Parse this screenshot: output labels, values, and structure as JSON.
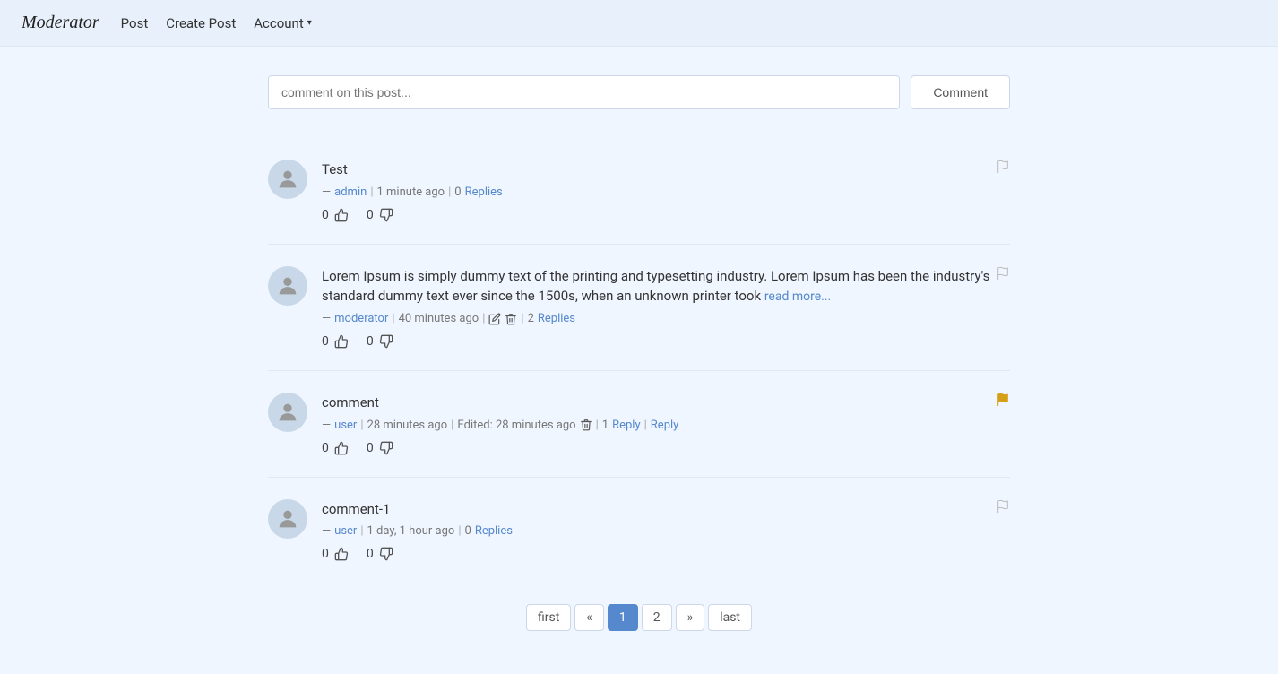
{
  "brand": "Moderator",
  "nav": {
    "post_label": "Post",
    "create_post_label": "Create Post",
    "account_label": "Account"
  },
  "comment_input": {
    "placeholder": "comment on this post...",
    "button_label": "Comment"
  },
  "comments": [
    {
      "id": 1,
      "text": "Test",
      "truncated": false,
      "author": "admin",
      "time": "1 minute ago",
      "reply_count": 0,
      "replies_label": "Replies",
      "can_edit": false,
      "can_delete": false,
      "edited": false,
      "upvotes": 0,
      "downvotes": 0,
      "flagged": false,
      "reply_label": null
    },
    {
      "id": 2,
      "text": "Lorem Ipsum is simply dummy text of the printing and typesetting industry. Lorem Ipsum has been the industry's standard dummy text ever since the 1500s, when an unknown printer took",
      "truncated": true,
      "read_more_label": "read more...",
      "author": "moderator",
      "time": "40 minutes ago",
      "reply_count": 2,
      "replies_label": "Replies",
      "can_edit": true,
      "can_delete": true,
      "edited": false,
      "upvotes": 0,
      "downvotes": 0,
      "flagged": false,
      "reply_label": null
    },
    {
      "id": 3,
      "text": "comment",
      "truncated": false,
      "author": "user",
      "time": "28 minutes ago",
      "edited": true,
      "edited_label": "Edited:",
      "reply_count": 1,
      "replies_label": "Reply",
      "can_edit": false,
      "can_delete": true,
      "upvotes": 0,
      "downvotes": 0,
      "flagged": true,
      "reply_label": "Reply"
    },
    {
      "id": 4,
      "text": "comment-1",
      "truncated": false,
      "author": "user",
      "time": "1 day, 1 hour ago",
      "reply_count": 0,
      "replies_label": "Replies",
      "can_edit": false,
      "can_delete": false,
      "edited": false,
      "upvotes": 0,
      "downvotes": 0,
      "flagged": false,
      "reply_label": null
    }
  ],
  "pagination": {
    "first_label": "first",
    "prev_label": "«",
    "next_label": "»",
    "last_label": "last",
    "current_page": 1,
    "pages": [
      1,
      2
    ]
  }
}
